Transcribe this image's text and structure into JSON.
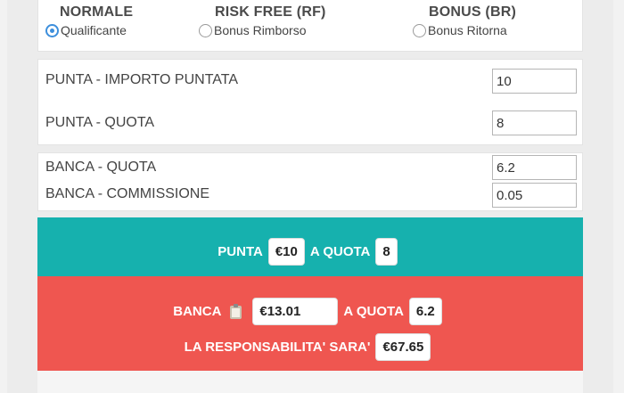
{
  "bet_types": [
    {
      "title": "NORMALE",
      "option": "Qualificante",
      "checked": true
    },
    {
      "title": "RISK FREE (RF)",
      "option": "Bonus Rimborso",
      "checked": false
    },
    {
      "title": "BONUS (BR)",
      "option": "Bonus Ritorna",
      "checked": false
    }
  ],
  "punta": {
    "importo_label": "PUNTA - IMPORTO PUNTATA",
    "importo_value": "10",
    "quota_label": "PUNTA - QUOTA",
    "quota_value": "8"
  },
  "banca": {
    "quota_label": "BANCA - QUOTA",
    "quota_value": "6.2",
    "commissione_label": "BANCA - COMMISSIONE",
    "commissione_value": "0.05"
  },
  "result_punta": {
    "prefix": "PUNTA",
    "amount": "€10",
    "mid": "A QUOTA",
    "quota": "8"
  },
  "result_banca": {
    "prefix": "BANCA",
    "amount": "€13.01",
    "mid": "A QUOTA",
    "quota": "6.2",
    "liability_label": "LA RESPONSABILITA' SARA'",
    "liability": "€67.65"
  },
  "colors": {
    "punta_panel": "#16b1ae",
    "banca_panel": "#ef5650",
    "radio_accent": "#3d8fdc"
  }
}
